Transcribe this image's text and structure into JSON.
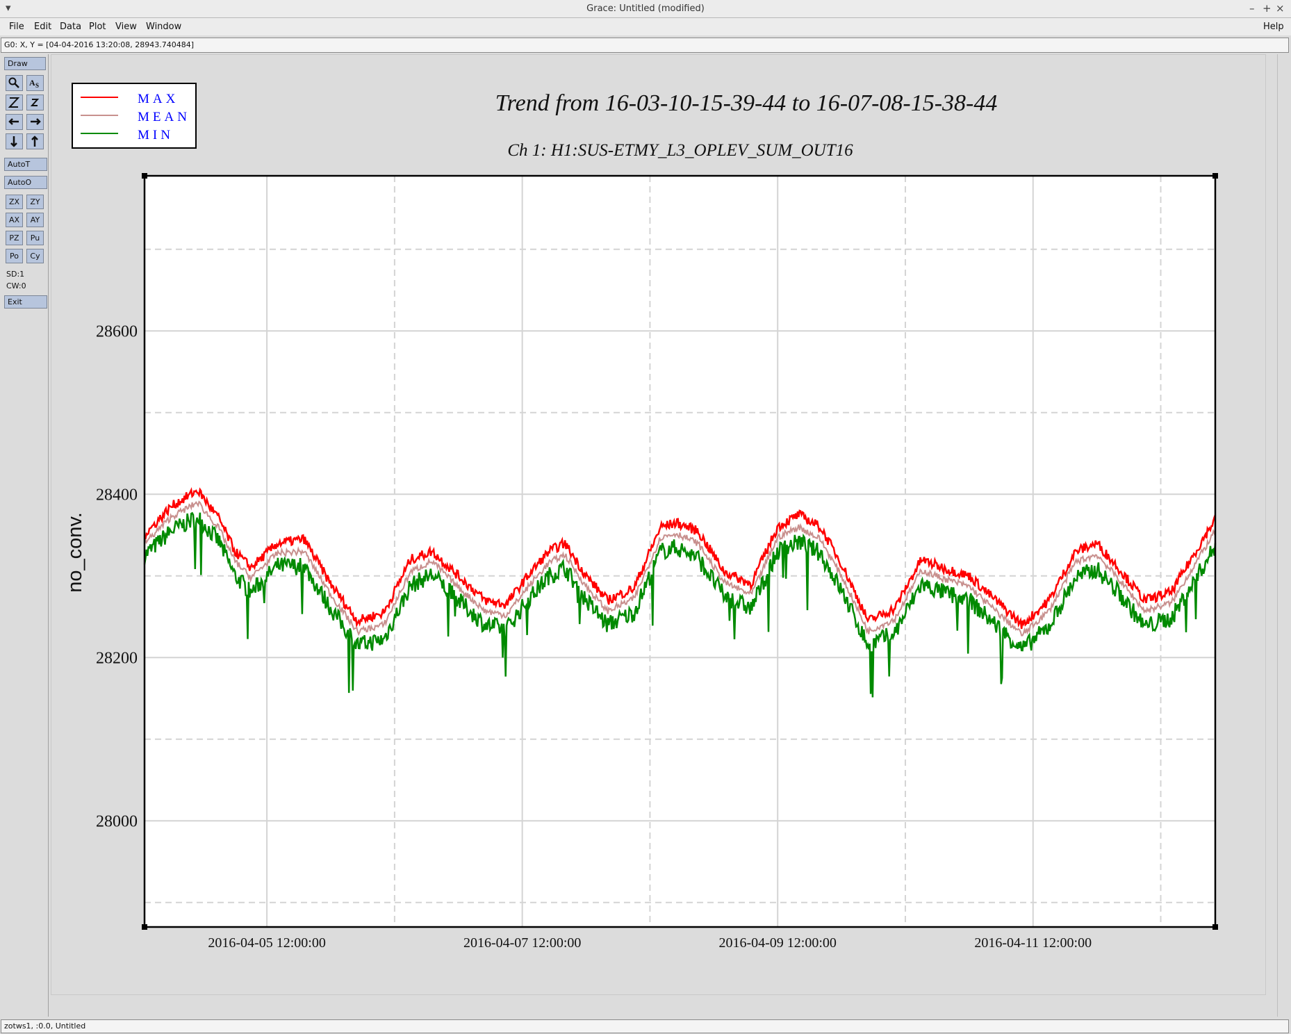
{
  "window": {
    "title": "Grace: Untitled (modified)",
    "controls": [
      "–",
      "+",
      "×"
    ]
  },
  "menu": {
    "items": [
      "File",
      "Edit",
      "Data",
      "Plot",
      "View",
      "Window"
    ],
    "help": "Help"
  },
  "coord_readout": "G0: X, Y = [04-04-2016 13:20:08, 28943.740484]",
  "status_text": "zotws1, :0.0, Untitled",
  "toolbox": {
    "draw": "Draw",
    "autot": "AutoT",
    "autoo": "AutoO",
    "small_buttons": [
      "ZX",
      "ZY",
      "AX",
      "AY",
      "PZ",
      "Pu",
      "Po",
      "Cy"
    ],
    "sd": "SD:1",
    "cw": "CW:0",
    "exit": "Exit",
    "icons": [
      "zoom-icon",
      "text-icon",
      "zoom-in-icon",
      "zoom-out-icon",
      "left-arrow-icon",
      "right-arrow-icon",
      "down-arrow-icon",
      "up-arrow-icon"
    ]
  },
  "chart_data": {
    "type": "line",
    "title": "Trend from 16-03-10-15-39-44 to 16-07-08-15-38-44",
    "subtitle": "Ch 1: H1:SUS-ETMY_L3_OPLEV_SUM_OUT16",
    "ylabel": "no_conv.",
    "xlabel": "",
    "ylim": [
      27870,
      28790
    ],
    "xlim": [
      "2016-04-04 13:00",
      "2016-04-12 22:15"
    ],
    "x_ticks": [
      "2016-04-05 12:00:00",
      "2016-04-07 12:00:00",
      "2016-04-09 12:00:00",
      "2016-04-11 12:00:00"
    ],
    "y_ticks": [
      28000,
      28200,
      28400,
      28600
    ],
    "grid": true,
    "legend_placement": "top-left",
    "legend": [
      "MAX",
      "MEAN",
      "MIN"
    ],
    "colors": {
      "MAX": "#ff0000",
      "MEAN": "#c8908e",
      "MIN": "#008a00",
      "legend_text": "#0000ff"
    },
    "x": [
      "2016-04-04 13:00",
      "2016-04-04 18:00",
      "2016-04-04 23:00",
      "2016-04-05 03:00",
      "2016-04-05 06:00",
      "2016-04-05 09:00",
      "2016-04-05 14:00",
      "2016-04-05 19:00",
      "2016-04-06 00:00",
      "2016-04-06 05:00",
      "2016-04-06 10:00",
      "2016-04-06 15:00",
      "2016-04-06 19:00",
      "2016-04-07 00:00",
      "2016-04-07 05:00",
      "2016-04-07 09:00",
      "2016-04-07 13:00",
      "2016-04-07 17:00",
      "2016-04-07 20:00",
      "2016-04-08 00:00",
      "2016-04-08 04:00",
      "2016-04-08 09:00",
      "2016-04-08 14:00",
      "2016-04-08 17:00",
      "2016-04-08 21:00",
      "2016-04-09 02:00",
      "2016-04-09 07:00",
      "2016-04-09 12:00",
      "2016-04-09 16:00",
      "2016-04-09 20:00",
      "2016-04-10 00:00",
      "2016-04-10 05:00",
      "2016-04-10 10:00",
      "2016-04-10 15:00",
      "2016-04-10 19:00",
      "2016-04-11 00:00",
      "2016-04-11 05:00",
      "2016-04-11 10:00",
      "2016-04-11 15:00",
      "2016-04-11 20:00",
      "2016-04-12 00:00",
      "2016-04-12 04:00",
      "2016-04-12 09:00",
      "2016-04-12 14:00",
      "2016-04-12 22:15"
    ],
    "series": [
      {
        "name": "MAX",
        "values": [
          28350,
          28385,
          28405,
          28370,
          28330,
          28310,
          28340,
          28345,
          28290,
          28245,
          28255,
          28320,
          28330,
          28300,
          28270,
          28265,
          28300,
          28330,
          28340,
          28300,
          28270,
          28285,
          28360,
          28365,
          28355,
          28305,
          28290,
          28360,
          28375,
          28360,
          28315,
          28245,
          28260,
          28320,
          28310,
          28300,
          28270,
          28240,
          28270,
          28330,
          28340,
          28310,
          28270,
          28280,
          28370,
          28335
        ]
      },
      {
        "name": "MEAN",
        "values": [
          28340,
          28372,
          28390,
          28358,
          28318,
          28298,
          28328,
          28330,
          28277,
          28232,
          28240,
          28305,
          28318,
          28286,
          28257,
          28252,
          28286,
          28316,
          28326,
          28287,
          28257,
          28272,
          28347,
          28352,
          28340,
          28292,
          28277,
          28347,
          28360,
          28345,
          28300,
          28232,
          28247,
          28307,
          28297,
          28287,
          28257,
          28228,
          28257,
          28317,
          28326,
          28297,
          28257,
          28267,
          28355,
          28322
        ]
      },
      {
        "name": "MIN",
        "values": [
          28325,
          28355,
          28372,
          28342,
          28300,
          28280,
          28312,
          28312,
          28260,
          28215,
          28222,
          28288,
          28302,
          28270,
          28240,
          28235,
          28270,
          28300,
          28310,
          28270,
          28240,
          28255,
          28330,
          28335,
          28322,
          28275,
          28260,
          28330,
          28342,
          28328,
          28282,
          28215,
          28230,
          28290,
          28280,
          28270,
          28240,
          28210,
          28238,
          28298,
          28308,
          28280,
          28238,
          28248,
          28336,
          28305
        ]
      }
    ]
  }
}
